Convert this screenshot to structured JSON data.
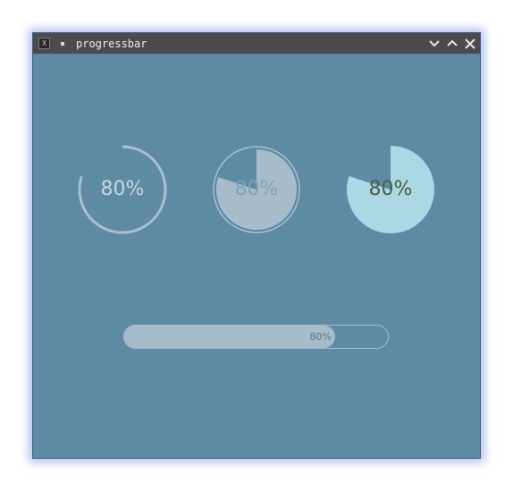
{
  "window": {
    "title": "progressbar",
    "app_icon": "x-terminal-icon",
    "app_icon_glyph": "X"
  },
  "titlebar_buttons": [
    {
      "name": "minimize-icon"
    },
    {
      "name": "maximize-icon"
    },
    {
      "name": "close-icon"
    }
  ],
  "progress": {
    "value": 0.8,
    "ring_label": "80%",
    "pie_label": "80%",
    "solid_pie_label": "80%",
    "bar_label": "80%"
  },
  "colors": {
    "window_background": "#5e8aa4",
    "titlebar": "#4d4a4f",
    "ring_stroke": "#a9bfce",
    "pie_fill": "#a7bccb",
    "solid_pie_fill": "#acd8e5",
    "bar_fill": "#a7bccb"
  }
}
